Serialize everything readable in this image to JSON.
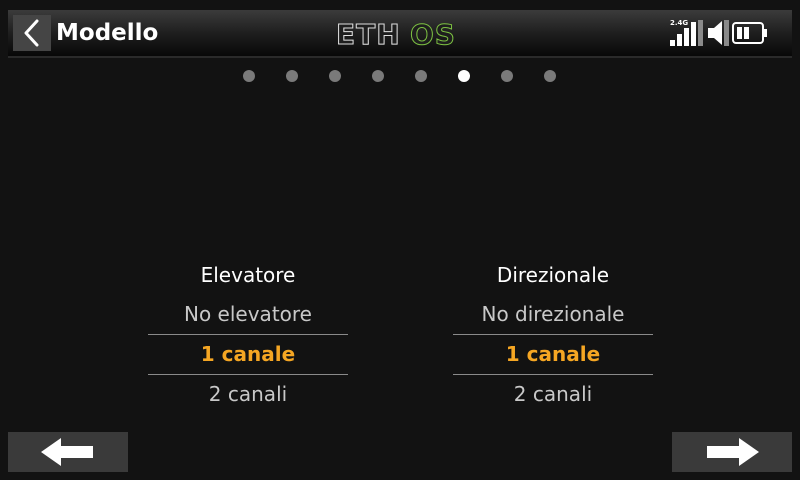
{
  "header": {
    "title": "Modello",
    "logo": "ETHOS",
    "logo_part1": "ETH",
    "logo_part2": "OS",
    "logo_accent_color": "#7dc242",
    "rf_band": "2.4G"
  },
  "pager": {
    "count": 8,
    "active_index": 5
  },
  "elevator": {
    "title": "Elevatore",
    "options": [
      "No elevatore",
      "1 canale",
      "2 canali"
    ],
    "selected_index": 1
  },
  "rudder": {
    "title": "Direzionale",
    "options": [
      "No direzionale",
      "1 canale",
      "2 canali"
    ],
    "selected_index": 1
  },
  "colors": {
    "selected": "#f5a623",
    "background": "#121212"
  },
  "icons": {
    "back": "chevron-left-icon",
    "signal": "signal-bars-icon",
    "volume": "speaker-icon",
    "battery": "battery-icon",
    "prev": "arrow-left-icon",
    "next": "arrow-right-icon"
  }
}
